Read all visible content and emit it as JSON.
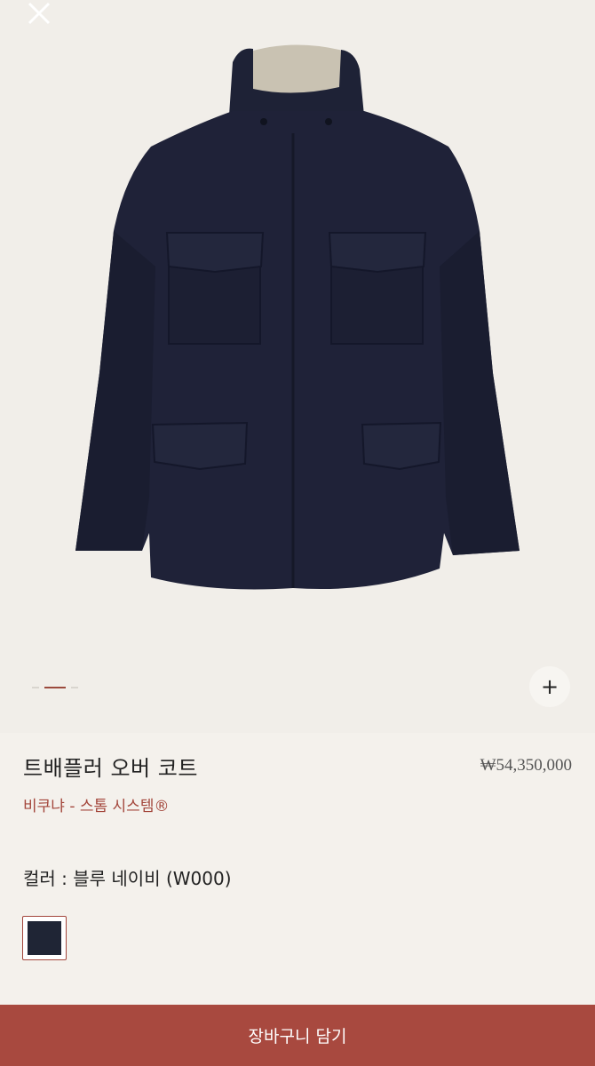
{
  "gallery": {
    "close_icon": "close-icon",
    "zoom_label": "+",
    "pager": {
      "count": 3,
      "active_index": 1
    }
  },
  "product": {
    "title": "트배플러 오버 코트",
    "price": "₩54,350,000",
    "subtitle": "비쿠냐 - 스톰 시스템®",
    "color_label": "컬러 : 블루 네이비 (W000)",
    "swatch_color": "#1f2535"
  },
  "cart": {
    "label": "장바구니 담기"
  },
  "colors": {
    "accent": "#a8493f",
    "background": "#f4f1ec",
    "coat": "#1f2238"
  }
}
